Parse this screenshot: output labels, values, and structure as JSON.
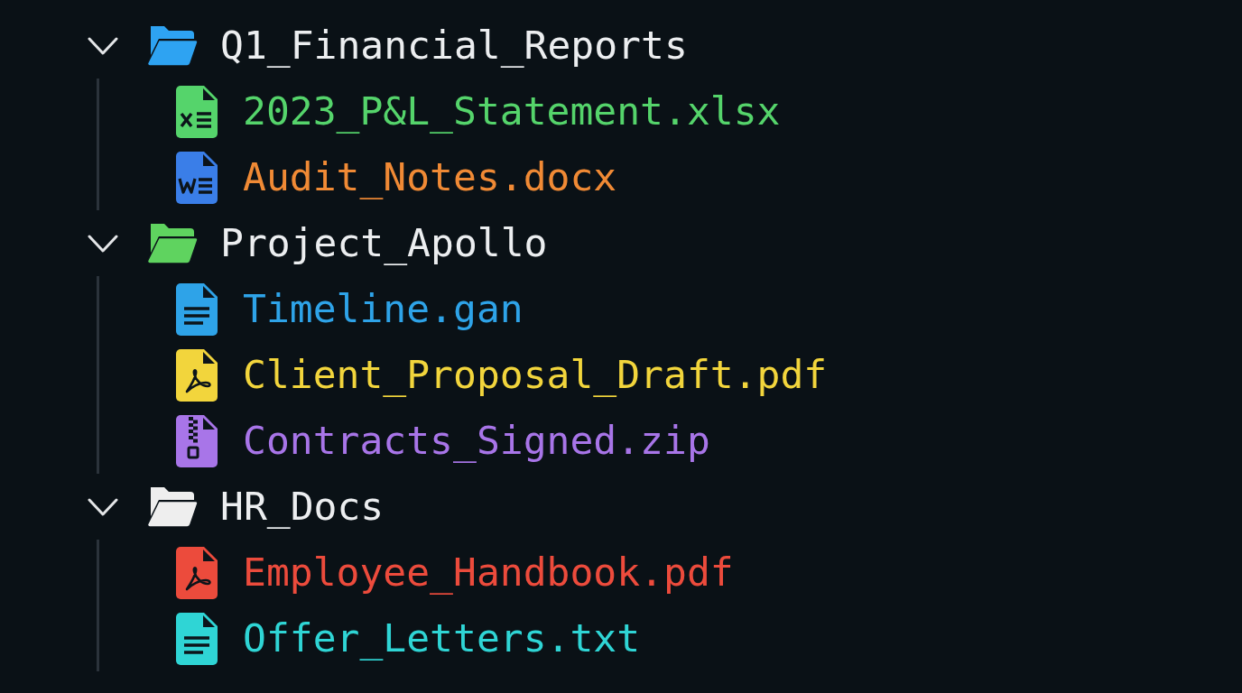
{
  "tree": [
    {
      "name": "Q1_Financial_Reports",
      "kind": "folder",
      "expanded": true,
      "color": "#2ea3f2",
      "children": [
        {
          "name": "2023_P&L_Statement.xlsx",
          "kind": "spreadsheet",
          "color": "#55d46b"
        },
        {
          "name": "Audit_Notes.docx",
          "kind": "word",
          "color": "#f08a35"
        }
      ]
    },
    {
      "name": "Project_Apollo",
      "kind": "folder",
      "expanded": true,
      "color": "#5fd35f",
      "children": [
        {
          "name": "Timeline.gan",
          "kind": "text",
          "color": "#2ea3e8"
        },
        {
          "name": "Client_Proposal_Draft.pdf",
          "kind": "pdf",
          "color": "#f2d53c"
        },
        {
          "name": "Contracts_Signed.zip",
          "kind": "archive",
          "color": "#a875e8"
        }
      ]
    },
    {
      "name": "HR_Docs",
      "kind": "folder",
      "expanded": true,
      "color": "#eeeeee",
      "children": [
        {
          "name": "Employee_Handbook.pdf",
          "kind": "pdf",
          "color": "#ec4b3c"
        },
        {
          "name": "Offer_Letters.txt",
          "kind": "text",
          "color": "#2fd5d5"
        }
      ]
    }
  ]
}
